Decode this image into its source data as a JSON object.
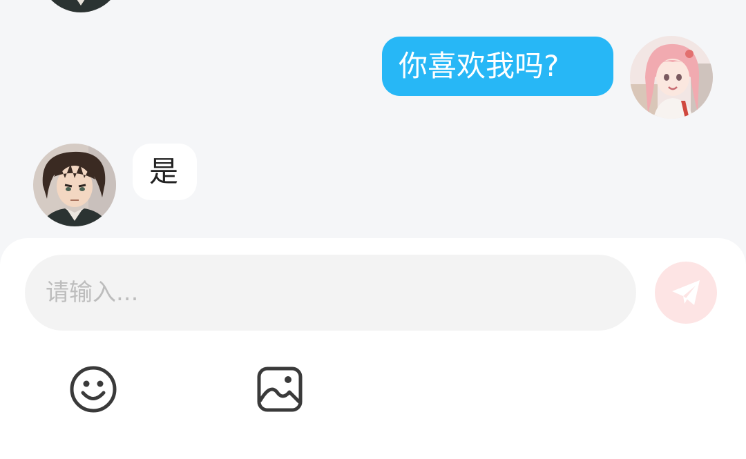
{
  "messages": [
    {
      "sender": "self",
      "text": "你喜欢我吗?"
    },
    {
      "sender": "other",
      "text": "是"
    }
  ],
  "input": {
    "placeholder": "请输入...",
    "value": ""
  },
  "toolbar": {
    "send_icon": "paper-plane-icon",
    "emoji_icon": "smiley-face-icon",
    "image_icon": "image-icon"
  },
  "colors": {
    "chat_background": "#f5f6f8",
    "outgoing_bubble": "#27b7f6",
    "incoming_bubble": "#ffffff",
    "send_button": "#fde4e4",
    "send_icon": "#f6a8a8",
    "input_background": "#f3f3f3"
  }
}
